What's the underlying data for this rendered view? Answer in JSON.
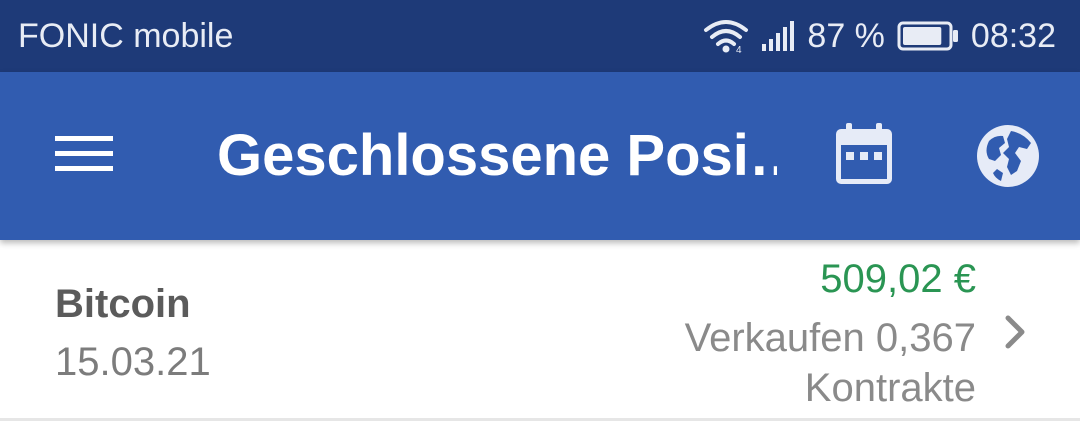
{
  "status_bar": {
    "carrier": "FONIC mobile",
    "battery_percent": "87 %",
    "battery_level": 0.87,
    "time": "08:32",
    "icons": [
      "wifi-icon",
      "signal-icon",
      "battery-icon"
    ]
  },
  "app_bar": {
    "title": "Geschlossene Posi…",
    "icons": [
      "menu-icon",
      "calendar-icon",
      "globe-icon"
    ]
  },
  "positions": [
    {
      "name": "Bitcoin",
      "date": "15.03.21",
      "amount": "509,02 €",
      "detail": "Verkaufen 0,367 Kontrakte"
    }
  ],
  "colors": {
    "status_bar": "#1e3a78",
    "app_bar": "#315cb0",
    "profit_green": "#2a9553"
  }
}
